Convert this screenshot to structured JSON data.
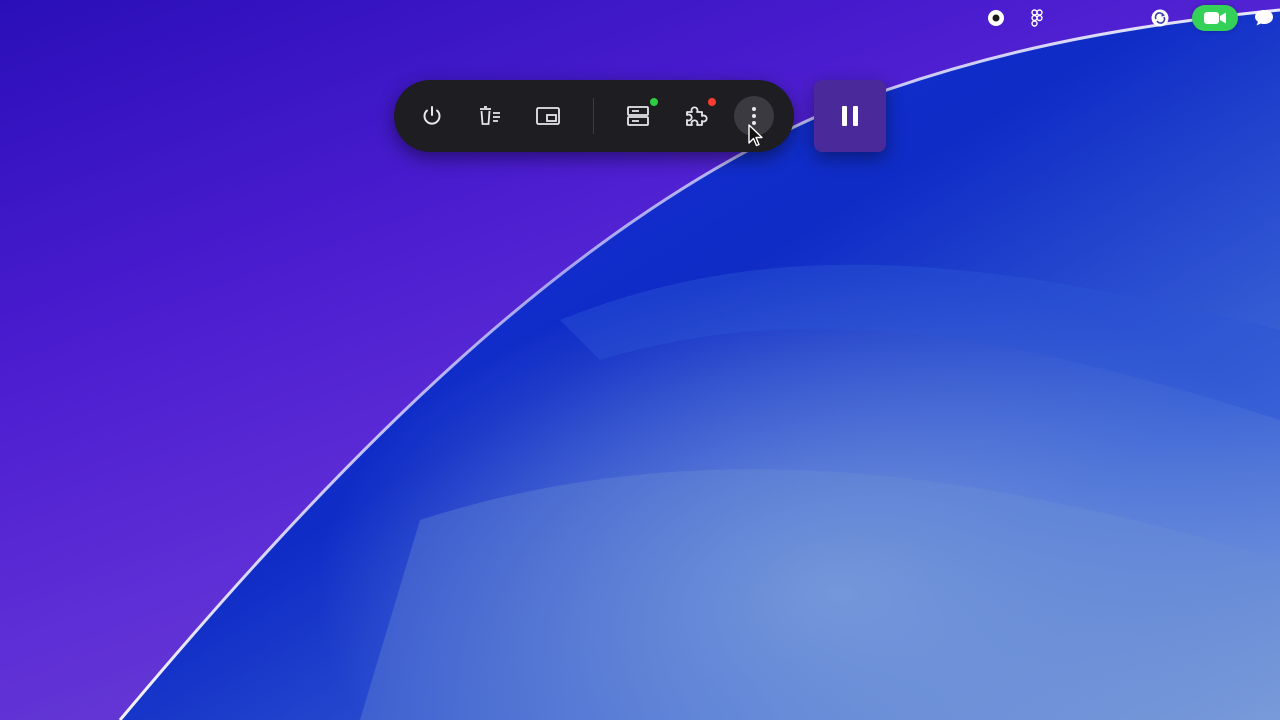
{
  "menubar": {
    "icons": [
      "record-icon",
      "figma-icon",
      "sync-icon",
      "facetime-video-icon",
      "chat-bubble-icon"
    ],
    "facetime_color": "#34d058"
  },
  "toolbar": {
    "buttons": [
      "power-icon",
      "delete-list-icon",
      "picture-in-picture-icon",
      "server-icon",
      "extension-puzzle-icon",
      "more-vertical-icon"
    ],
    "server_status_color": "#2ecc40",
    "extension_status_color": "#ff3b30",
    "hovered": "more-vertical-icon"
  },
  "pause_control": {
    "icon": "pause-icon",
    "color": "#4a2a9a"
  },
  "wallpaper": {
    "colors": [
      "#2a0fb8",
      "#5e2ed6",
      "#0a2ad0",
      "#6a8fd8"
    ]
  }
}
